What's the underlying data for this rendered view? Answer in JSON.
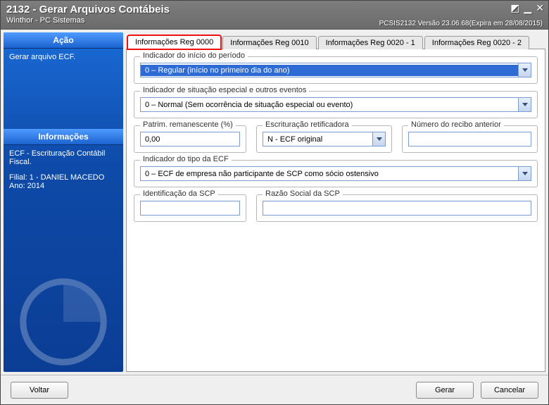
{
  "titlebar": {
    "title": "2132 - Gerar Arquivos Contábeis",
    "subtitle": "Winthor - PC Sistemas",
    "sysinfo": "PCSIS2132   Versão 23.06.68(Expira em 28/08/2015)"
  },
  "sidebar": {
    "hdr_action": "Ação",
    "action_item": "Gerar arquivo ECF.",
    "hdr_info": "Informações",
    "info_line1": "ECF - Escrituração Contábil Fiscal.",
    "info_line2": "Filial: 1 - DANIEL MACEDO",
    "info_line3": "Ano: 2014"
  },
  "tabs": [
    {
      "label": "Informações Reg 0000"
    },
    {
      "label": "Informações Reg 0010"
    },
    {
      "label": "Informações Reg 0020 - 1"
    },
    {
      "label": "Informações Reg 0020 - 2"
    }
  ],
  "form": {
    "grp_inicio": {
      "legend": "Indicador do início do período",
      "value": "0 – Regular (início no primeiro dia do ano)"
    },
    "grp_sit": {
      "legend": "Indicador de situação especial e outros eventos",
      "value": "0 – Normal (Sem ocorrência de situação especial ou evento)"
    },
    "grp_patrim": {
      "legend": "Patrim. remanescente (%)",
      "value": "0,00"
    },
    "grp_retif": {
      "legend": "Escrituração retificadora",
      "value": "N - ECF original"
    },
    "grp_recibo": {
      "legend": "Número do recibo anterior",
      "value": ""
    },
    "grp_tipoecf": {
      "legend": "Indicador do tipo da ECF",
      "value": "0 – ECF de empresa não participante de SCP como sócio ostensivo"
    },
    "grp_identscp": {
      "legend": "Identificação da SCP",
      "value": ""
    },
    "grp_razaoscp": {
      "legend": "Razão Social da SCP",
      "value": ""
    }
  },
  "footer": {
    "back": "Voltar",
    "generate": "Gerar",
    "cancel": "Cancelar"
  }
}
